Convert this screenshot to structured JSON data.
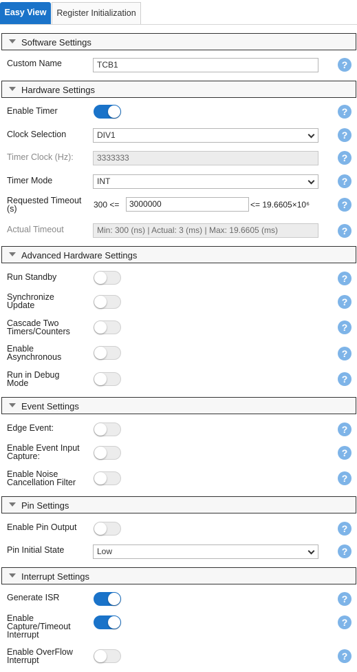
{
  "tabs": {
    "easy_view": "Easy View",
    "register_init": "Register Initialization"
  },
  "help_glyph": "?",
  "colors": {
    "accent": "#1a73c9",
    "help": "#7eb4e8"
  },
  "sections": {
    "software": "Software Settings",
    "hardware": "Hardware Settings",
    "advanced": "Advanced Hardware Settings",
    "event": "Event Settings",
    "pin": "Pin Settings",
    "interrupt": "Interrupt Settings"
  },
  "software": {
    "custom_name_label": "Custom Name",
    "custom_name_value": "TCB1"
  },
  "hardware": {
    "enable_timer_label": "Enable Timer",
    "enable_timer": true,
    "clock_selection_label": "Clock Selection",
    "clock_selection_value": "DIV1",
    "timer_clock_label": "Timer Clock (Hz):",
    "timer_clock_value": "3333333",
    "timer_mode_label": "Timer Mode",
    "timer_mode_value": "INT",
    "requested_timeout_label_1": "Requested Timeout",
    "requested_timeout_label_2": "(s)",
    "timeout_min_text": "300 <=",
    "timeout_value": "3000000",
    "timeout_max_text": "<= 19.6605×10⁶",
    "actual_timeout_label": "Actual Timeout",
    "actual_timeout_value": "Min: 300 (ns) | Actual: 3 (ms) |  Max: 19.6605 (ms)"
  },
  "advanced": {
    "run_standby_label": "Run Standby",
    "run_standby": false,
    "sync_update_label_1": "Synchronize",
    "sync_update_label_2": "Update",
    "sync_update": false,
    "cascade_label_1": "Cascade Two",
    "cascade_label_2": "Timers/Counters",
    "cascade": false,
    "async_label_1": "Enable",
    "async_label_2": "Asynchronous",
    "async": false,
    "debug_label_1": "Run in Debug",
    "debug_label_2": "Mode",
    "debug": false
  },
  "event": {
    "edge_event_label": "Edge Event:",
    "edge_event": false,
    "input_capture_label_1": "Enable Event Input",
    "input_capture_label_2": "Capture:",
    "input_capture": false,
    "noise_label_1": "Enable Noise",
    "noise_label_2": "Cancellation Filter",
    "noise": false
  },
  "pin": {
    "pin_output_label": "Enable Pin Output",
    "pin_output": false,
    "initial_state_label": "Pin Initial State",
    "initial_state_value": "Low"
  },
  "interrupt": {
    "generate_isr_label": "Generate ISR",
    "generate_isr": true,
    "capture_timeout_label_1": "Enable",
    "capture_timeout_label_2": "Capture/Timeout",
    "capture_timeout_label_3": "Interrupt",
    "capture_timeout": true,
    "overflow_label_1": "Enable OverFlow",
    "overflow_label_2": "Interrupt",
    "overflow": false
  }
}
